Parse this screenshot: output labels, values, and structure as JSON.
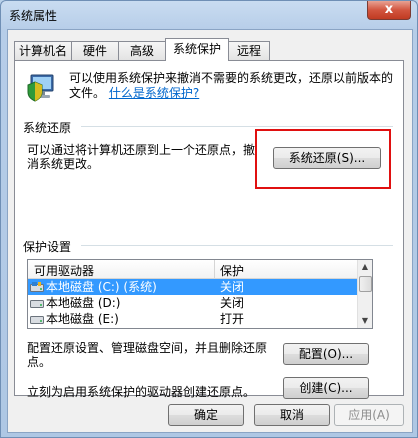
{
  "window": {
    "title": "系统属性",
    "close_label": "x"
  },
  "tabs": [
    {
      "label": "计算机名"
    },
    {
      "label": "硬件"
    },
    {
      "label": "高级"
    },
    {
      "label": "系统保护",
      "active": true
    },
    {
      "label": "远程"
    }
  ],
  "intro": {
    "text": "可以使用系统保护来撤消不需要的系统更改，还原以前版本的文件。",
    "link": "什么是系统保护?"
  },
  "restore": {
    "group_title": "系统还原",
    "description": "可以通过将计算机还原到上一个还原点，撤消系统更改。",
    "button": "系统还原(S)..."
  },
  "protection": {
    "group_title": "保护设置",
    "columns": [
      "可用驱动器",
      "保护"
    ],
    "rows": [
      {
        "drive": "本地磁盘 (C:) (系统)",
        "status": "关闭",
        "selected": true
      },
      {
        "drive": "本地磁盘 (D:)",
        "status": "关闭"
      },
      {
        "drive": "本地磁盘 (E:)",
        "status": "打开"
      }
    ],
    "configure_text": "配置还原设置、管理磁盘空间，并且删除还原点。",
    "configure_button": "配置(O)...",
    "create_text": "立刻为启用系统保护的驱动器创建还原点。",
    "create_button": "创建(C)..."
  },
  "footer": {
    "ok": "确定",
    "cancel": "取消",
    "apply": "应用(A)"
  },
  "colors": {
    "highlight": "#e01010",
    "selection": "#3399ff",
    "link": "#0066cc"
  }
}
